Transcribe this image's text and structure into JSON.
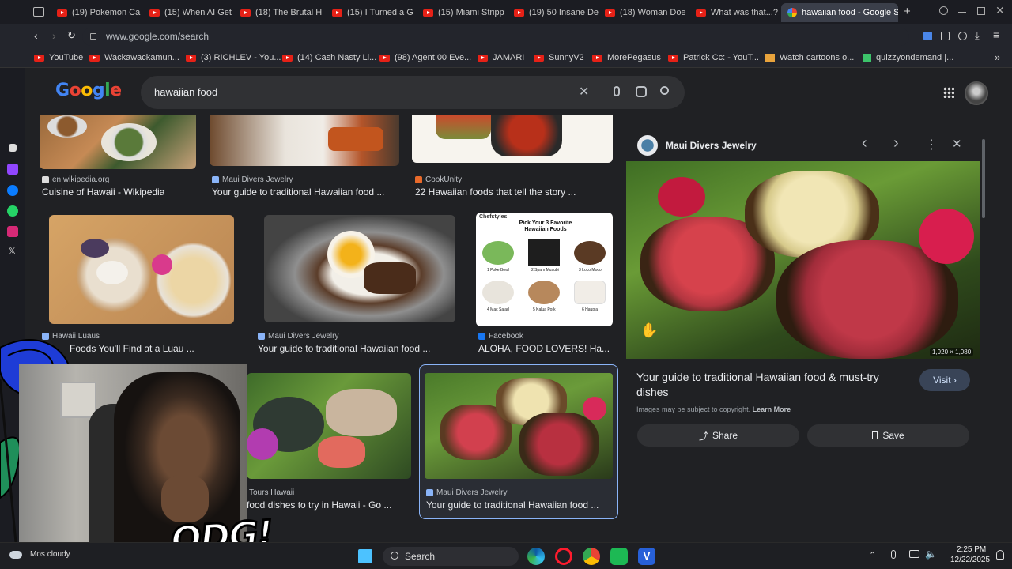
{
  "tabs": [
    {
      "label": "(19) Pokemon Ca"
    },
    {
      "label": "(15) When AI Get"
    },
    {
      "label": "(18) The Brutal H"
    },
    {
      "label": "(15) I Turned a G"
    },
    {
      "label": "(15) Miami Stripp"
    },
    {
      "label": "(19) 50 Insane De"
    },
    {
      "label": "(18) Woman Doe"
    },
    {
      "label": "What was that...?"
    },
    {
      "label": "hawaiian food - Google Se"
    }
  ],
  "address": {
    "url": "www.google.com/search"
  },
  "bookmarks": [
    {
      "label": "YouTube"
    },
    {
      "label": "Wackawackamun..."
    },
    {
      "label": "(3) RICHLEV - You..."
    },
    {
      "label": "(14) Cash Nasty Li..."
    },
    {
      "label": "(98) Agent 00 Eve..."
    },
    {
      "label": "JAMARI"
    },
    {
      "label": "SunnyV2"
    },
    {
      "label": "MorePegasus"
    },
    {
      "label": "Patrick Cc: - YouT..."
    },
    {
      "label": "Watch cartoons o..."
    },
    {
      "label": "quizzyondemand |..."
    }
  ],
  "search": {
    "query": "hawaiian food"
  },
  "results_row1": [
    {
      "source": "en.wikipedia.org",
      "caption": "Cuisine of Hawaii - Wikipedia"
    },
    {
      "source": "Maui Divers Jewelry",
      "caption": "Your guide to traditional Hawaiian food ..."
    },
    {
      "source": "CookUnity",
      "caption": "22 Hawaiian foods that tell the story ..."
    }
  ],
  "results_row2": [
    {
      "source": "Hawaii Luaus",
      "caption": "Foods You'll Find at a Luau ..."
    },
    {
      "source": "Maui Divers Jewelry",
      "caption": "Your guide to traditional Hawaiian food ..."
    },
    {
      "source": "Facebook",
      "caption": "ALOHA, FOOD LOVERS! Ha..."
    }
  ],
  "results_row3": [
    {
      "source": "Tours Hawaii",
      "caption": "food dishes to try in Hawaii - Go ..."
    },
    {
      "source": "Maui Divers Jewelry",
      "caption": "Your guide to traditional Hawaiian food ..."
    }
  ],
  "infographic": {
    "brand": "Chefstyles",
    "title": "Pick Your 3 Favorite Hawaiian Foods",
    "items": [
      "1 Poke Bowl",
      "2 Spam Musubi",
      "3 Loco Moco",
      "4 Mac Salad",
      "5 Kalua Pork",
      "6 Haupia"
    ]
  },
  "panel": {
    "site": "Maui Divers Jewelry",
    "dimensions": "1,920 × 1,080",
    "title": "Your guide to traditional Hawaiian food & must-try dishes",
    "copyright": "Images may be subject to copyright.",
    "learn_more": "Learn More",
    "visit": "Visit",
    "share": "Share",
    "save": "Save"
  },
  "taskbar": {
    "weather": "cloudy",
    "weather_prefix": "Mos",
    "search": "Search",
    "time": "2:25 PM",
    "date": "12/22/2025"
  },
  "overlay": {
    "logo_text": "ODG!"
  },
  "colors": {
    "accent_blue": "#8ab4f8",
    "visit_bg": "#394457",
    "youtube_red": "#e62117"
  }
}
